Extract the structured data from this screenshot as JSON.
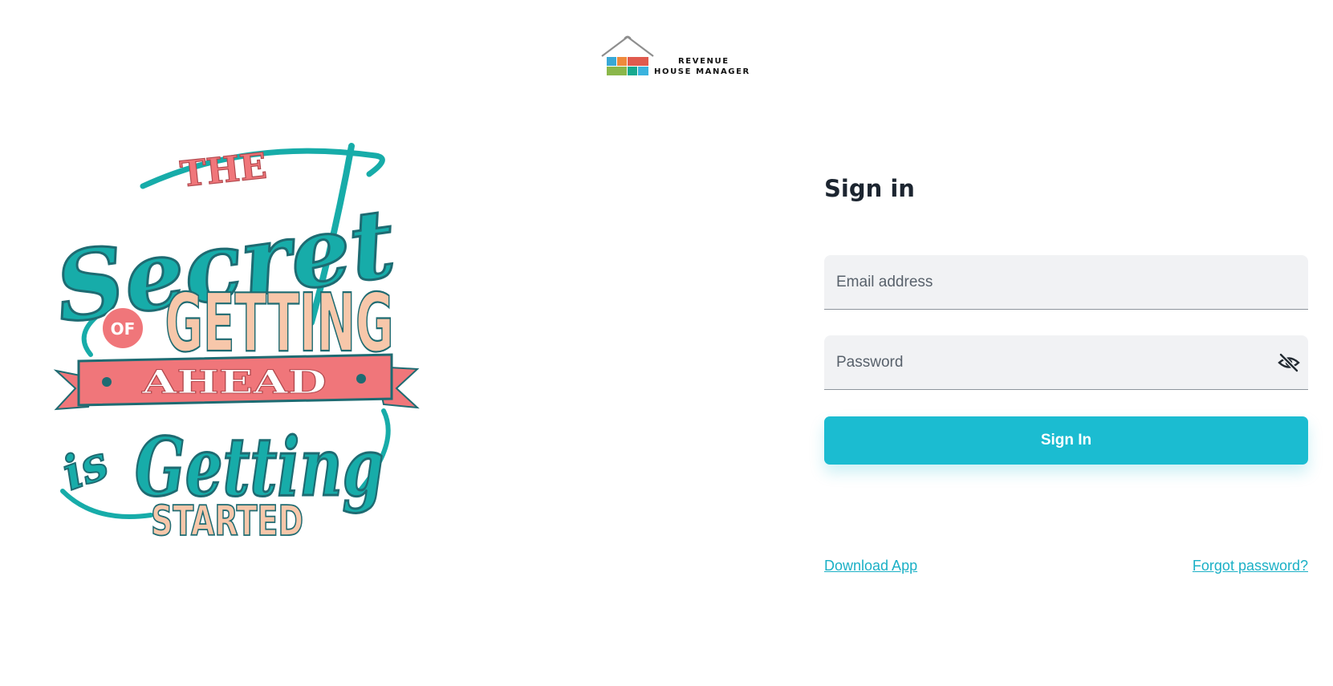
{
  "logo": {
    "line1": "REVENUE",
    "line2": "HOUSE MANAGER",
    "colors": [
      "#39a8d6",
      "#ef8a3c",
      "#e05a4e",
      "#8bb74a",
      "#17a98f",
      "#3ab3de"
    ]
  },
  "artwork": {
    "icon": "lettering-illustration",
    "words": {
      "the": "THE",
      "secret": "Secret",
      "of": "OF",
      "getting": "GETTING",
      "ahead": "AHEAD",
      "is": "is",
      "getting2": "Getting",
      "started": "STARTED"
    },
    "colors": {
      "teal": "#17aca9",
      "teal_dark": "#1e6b72",
      "coral": "#f0767a",
      "peach": "#f7c7aa"
    }
  },
  "form": {
    "title": "Sign in",
    "email_placeholder": "Email address",
    "email_value": "",
    "password_placeholder": "Password",
    "password_value": "",
    "password_toggle_icon": "eye-off-icon",
    "submit_label": "Sign In",
    "download_link": "Download App",
    "forgot_link": "Forgot password?"
  },
  "colors": {
    "accent": "#1bbcd1",
    "field_bg": "#f1f2f4",
    "link": "#1bb0c6"
  }
}
